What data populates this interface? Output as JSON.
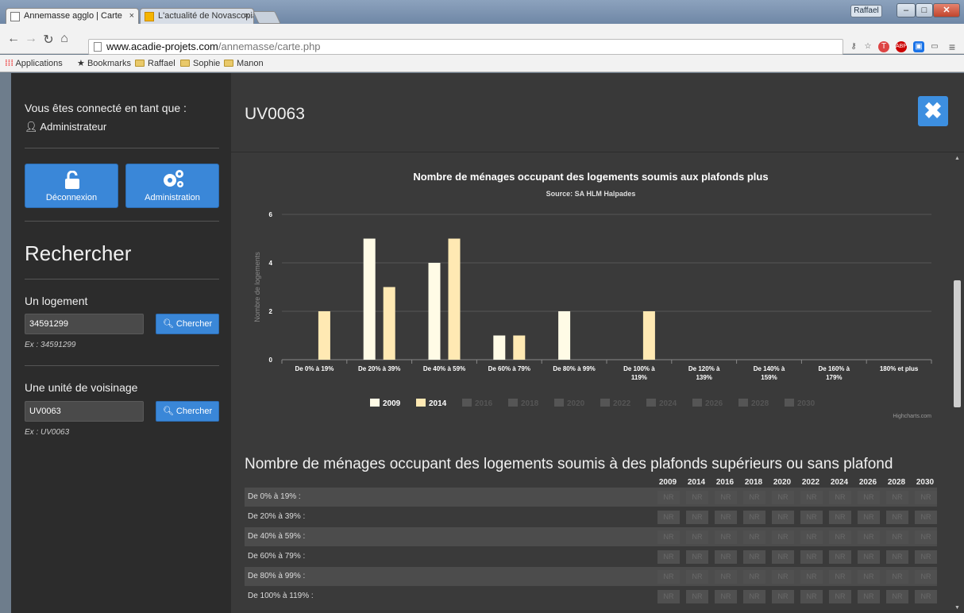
{
  "browser": {
    "tabs": [
      {
        "title": "Annemasse agglo | Carte",
        "close": "×"
      },
      {
        "title": "L'actualité de Novascopia",
        "close": "×"
      }
    ],
    "user_button": "Raffael",
    "url_host": "www.acadie-projets.com",
    "url_path": "/annemasse/carte.php",
    "bookmarks": [
      "Applications",
      "Bookmarks",
      "Raffael",
      "Sophie",
      "Manon"
    ]
  },
  "sidebar": {
    "connected_label": "Vous êtes connecté en tant que :",
    "user_name": "Administrateur",
    "logout_label": "Déconnexion",
    "admin_label": "Administration",
    "search_title": "Rechercher",
    "housing": {
      "label": "Un logement",
      "value": "34591299",
      "button": "Chercher",
      "example": "Ex : 34591299"
    },
    "neighborhood": {
      "label": "Une unité de voisinage",
      "value": "UV0063",
      "button": "Chercher",
      "example": "Ex : UV0063"
    }
  },
  "main": {
    "title": "UV0063",
    "table_title": "Nombre de ménages occupant des logements soumis à des plafonds supérieurs ou sans plafond",
    "years": [
      "2009",
      "2014",
      "2016",
      "2018",
      "2020",
      "2022",
      "2024",
      "2026",
      "2028",
      "2030"
    ],
    "rows": [
      "De 0% à 19% :",
      "De 20% à 39% :",
      "De 40% à 59% :",
      "De 60% à 79% :",
      "De 80% à 99% :",
      "De 100% à 119% :"
    ],
    "cell_value": "NR"
  },
  "chart_data": {
    "type": "bar",
    "title": "Nombre de ménages occupant des logements soumis aux plafonds plus",
    "subtitle": "Source: SA HLM Halpades",
    "ylabel": "Nombre de logements",
    "xlabel": "",
    "ylim": [
      0,
      6
    ],
    "yticks": [
      0,
      2,
      4,
      6
    ],
    "categories": [
      "De 0% à 19%",
      "De 20% à 39%",
      "De 40% à 59%",
      "De 60% à 79%",
      "De 80% à 99%",
      "De 100% à 119%",
      "De 120% à 139%",
      "De 140% à 159%",
      "De 160% à 179%",
      "180% et plus"
    ],
    "series": [
      {
        "name": "2009",
        "color": "#fffbe6",
        "values": [
          0,
          5,
          4,
          1,
          2,
          0,
          0,
          0,
          0,
          0
        ],
        "visible": true
      },
      {
        "name": "2014",
        "color": "#ffe9b3",
        "values": [
          2,
          3,
          5,
          1,
          0,
          2,
          0,
          0,
          0,
          0
        ],
        "visible": true
      },
      {
        "name": "2016",
        "visible": false
      },
      {
        "name": "2018",
        "visible": false
      },
      {
        "name": "2020",
        "visible": false
      },
      {
        "name": "2022",
        "visible": false
      },
      {
        "name": "2024",
        "visible": false
      },
      {
        "name": "2026",
        "visible": false
      },
      {
        "name": "2028",
        "visible": false
      },
      {
        "name": "2030",
        "visible": false
      }
    ],
    "credits": "Highcharts.com",
    "grid": true,
    "legend": "bottom-center"
  }
}
